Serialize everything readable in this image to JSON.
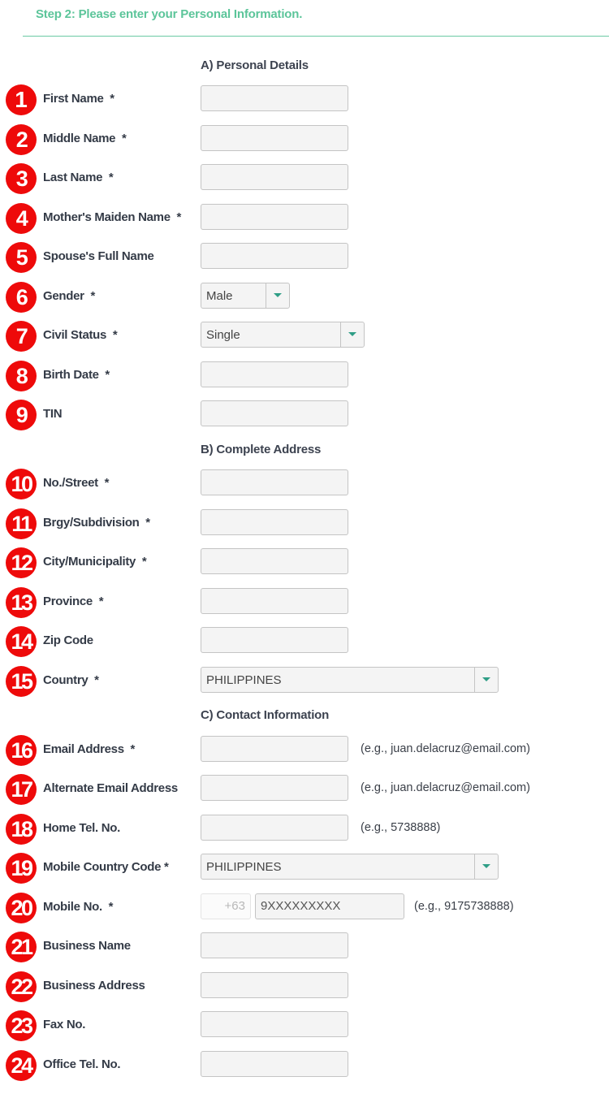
{
  "header": {
    "title": "Step 2: Please enter your Personal Information."
  },
  "sections": {
    "personal": "A) Personal Details",
    "address": "B) Complete Address",
    "contact": "C) Contact Information"
  },
  "accent_color": "#5cc59a",
  "badge_color": "#ee0a0a",
  "fields": [
    {
      "num": "1",
      "label": "First Name  *"
    },
    {
      "num": "2",
      "label": "Middle Name  *"
    },
    {
      "num": "3",
      "label": "Last Name  *"
    },
    {
      "num": "4",
      "label": "Mother's Maiden Name  *"
    },
    {
      "num": "5",
      "label": "Spouse's Full Name"
    },
    {
      "num": "6",
      "label": "Gender  *",
      "type": "select",
      "value": "Male"
    },
    {
      "num": "7",
      "label": "Civil Status  *",
      "type": "select",
      "value": "Single"
    },
    {
      "num": "8",
      "label": "Birth Date  *"
    },
    {
      "num": "9",
      "label": "TIN"
    },
    {
      "num": "10",
      "label": "No./Street  *"
    },
    {
      "num": "11",
      "label": "Brgy/Subdivision  *"
    },
    {
      "num": "12",
      "label": "City/Municipality  *"
    },
    {
      "num": "13",
      "label": "Province  *"
    },
    {
      "num": "14",
      "label": "Zip Code"
    },
    {
      "num": "15",
      "label": "Country  *",
      "type": "select",
      "value": "PHILIPPINES"
    },
    {
      "num": "16",
      "label": "Email Address  *",
      "hint": "(e.g., juan.delacruz@email.com)"
    },
    {
      "num": "17",
      "label": "Alternate Email Address",
      "hint": "(e.g., juan.delacruz@email.com)"
    },
    {
      "num": "18",
      "label": "Home Tel. No.",
      "hint": "(e.g., 5738888)"
    },
    {
      "num": "19",
      "label": "Mobile Country Code *",
      "type": "select",
      "value": "PHILIPPINES"
    },
    {
      "num": "20",
      "label": "Mobile No.  *",
      "prefix": "+63",
      "placeholder": "9XXXXXXXXX",
      "hint": "(e.g., 9175738888)"
    },
    {
      "num": "21",
      "label": "Business Name"
    },
    {
      "num": "22",
      "label": "Business Address"
    },
    {
      "num": "23",
      "label": "Fax No."
    },
    {
      "num": "24",
      "label": "Office Tel. No."
    }
  ]
}
